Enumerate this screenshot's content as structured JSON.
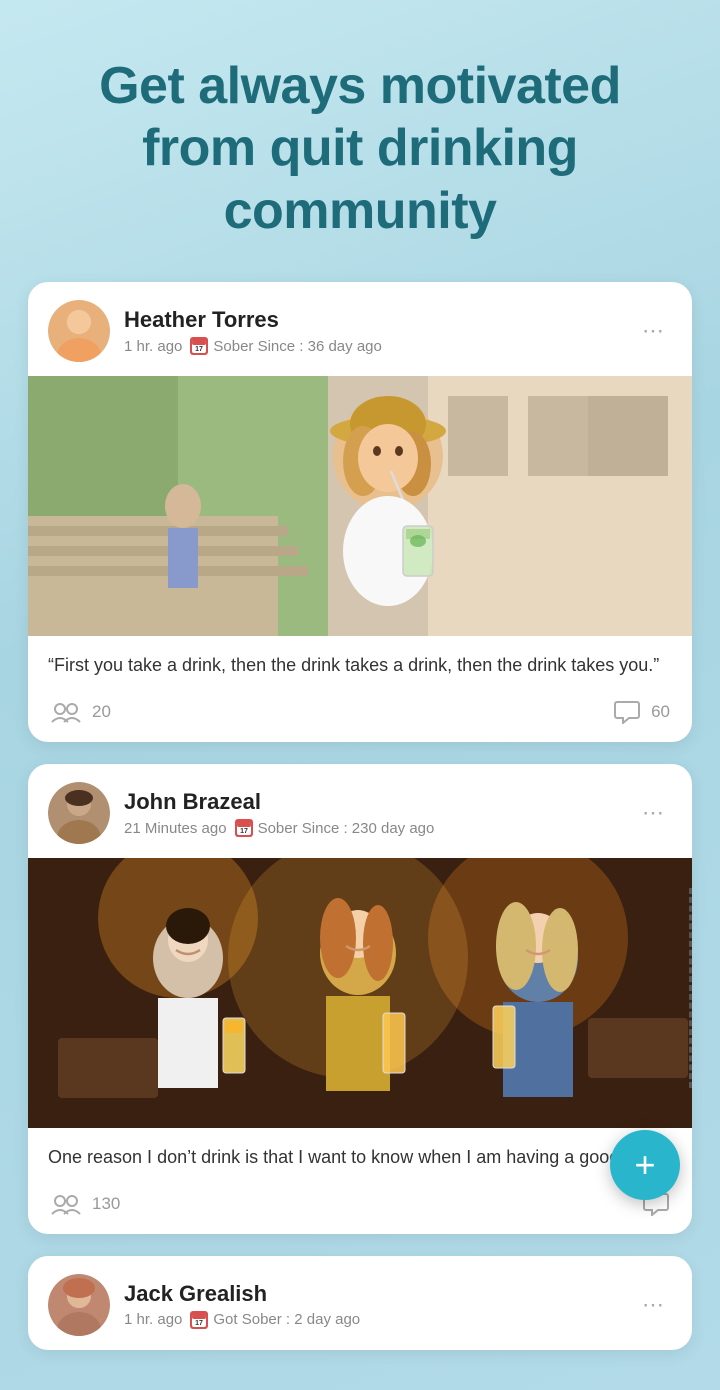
{
  "header": {
    "title": "Get always motivated from quit drinking community"
  },
  "posts": [
    {
      "id": "post-heather",
      "user": {
        "name": "Heather Torres",
        "time_ago": "1 hr. ago",
        "sober_label": "Sober Since : 36 day ago",
        "calendar_num": "17",
        "avatar_type": "heather"
      },
      "quote": "“First you take a drink, then the drink takes a drink, then the drink takes you.”",
      "reactions": {
        "likes": "20",
        "comments": "60"
      }
    },
    {
      "id": "post-john",
      "user": {
        "name": "John Brazeal",
        "time_ago": "21 Minutes ago",
        "sober_label": "Sober Since : 230 day ago",
        "calendar_num": "17",
        "avatar_type": "john"
      },
      "quote": "One reason I don’t drink is that I want to know when I am having a good time.”",
      "reactions": {
        "likes": "130",
        "comments": ""
      }
    },
    {
      "id": "post-jack",
      "user": {
        "name": "Jack Grealish",
        "time_ago": "1 hr. ago",
        "sober_label": "Got Sober : 2 day ago",
        "calendar_num": "17",
        "avatar_type": "jack"
      },
      "quote": "",
      "reactions": {
        "likes": "",
        "comments": ""
      }
    }
  ],
  "fab": {
    "label": "+"
  }
}
